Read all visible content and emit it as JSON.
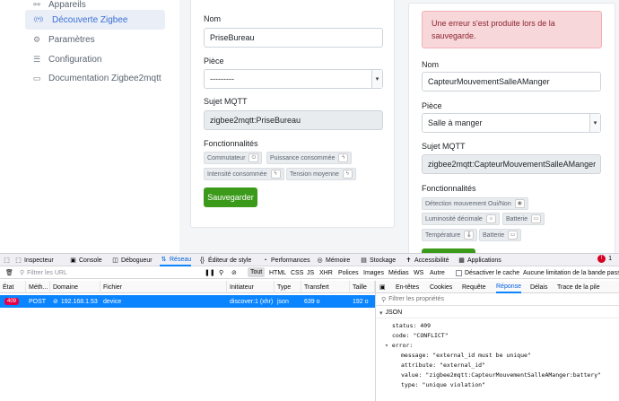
{
  "sidebar": {
    "items": [
      {
        "label": "Appareils",
        "icon": "link-icon",
        "glyph": "⚯",
        "active": false
      },
      {
        "label": "Découverte Zigbee",
        "icon": "broadcast-icon",
        "glyph": "((•))",
        "active": true
      },
      {
        "label": "Paramètres",
        "icon": "gear-icon",
        "glyph": "⚙",
        "active": false
      },
      {
        "label": "Configuration",
        "icon": "sliders-icon",
        "glyph": "☰",
        "active": false
      },
      {
        "label": "Documentation Zigbee2mqtt",
        "icon": "document-icon",
        "glyph": "▭",
        "active": false
      }
    ]
  },
  "card1": {
    "nom_label": "Nom",
    "nom_value": "PriseBureau",
    "piece_label": "Pièce",
    "piece_value": "---------",
    "sujet_label": "Sujet MQTT",
    "sujet_value": "zigbee2mqtt:PriseBureau",
    "fonctions_label": "Fonctionnalités",
    "tags": [
      {
        "label": "Commutateur",
        "icon": "power-icon",
        "glyph": "⏻"
      },
      {
        "label": "Puissance consommée",
        "icon": "bolt-icon",
        "glyph": "ϟ"
      },
      {
        "label": "Intensité consommée",
        "icon": "bolt-icon",
        "glyph": "ϟ"
      },
      {
        "label": "Tension moyenne",
        "icon": "bolt-icon",
        "glyph": "ϟ"
      }
    ],
    "save_label": "Sauvegarder"
  },
  "card2": {
    "alert": "Une erreur s'est produite lors de la sauvegarde.",
    "nom_label": "Nom",
    "nom_value": "CapteurMouvementSalleAManger",
    "piece_label": "Pièce",
    "piece_value": "Salle à manger",
    "sujet_label": "Sujet MQTT",
    "sujet_value": "zigbee2mqtt:CapteurMouvementSalleAManger",
    "fonctions_label": "Fonctionnalités",
    "tags": [
      {
        "label": "Détection mouvement Oui/Non",
        "icon": "eye-icon",
        "glyph": "◉"
      },
      {
        "label": "Luminosité décimale",
        "icon": "sun-icon",
        "glyph": "☼"
      },
      {
        "label": "Batterie",
        "icon": "battery-icon",
        "glyph": "▭"
      },
      {
        "label": "Température",
        "icon": "thermometer-icon",
        "glyph": "🌡"
      },
      {
        "label": "Batterie",
        "icon": "battery-icon",
        "glyph": "▭"
      }
    ]
  },
  "devtools": {
    "tabs": [
      {
        "label": "Inspecteur",
        "glyph": "⬚",
        "icon": "inspector-icon"
      },
      {
        "label": "Console",
        "glyph": "▣",
        "icon": "console-icon"
      },
      {
        "label": "Débogueur",
        "glyph": "◫",
        "icon": "debugger-icon"
      },
      {
        "label": "Réseau",
        "glyph": "⇅",
        "icon": "network-icon",
        "active": true
      },
      {
        "label": "Éditeur de style",
        "glyph": "{}",
        "icon": "style-editor-icon"
      },
      {
        "label": "Performances",
        "glyph": "◔",
        "icon": "performance-icon"
      },
      {
        "label": "Mémoire",
        "glyph": "◎",
        "icon": "memory-icon"
      },
      {
        "label": "Stockage",
        "glyph": "▤",
        "icon": "storage-icon"
      },
      {
        "label": "Accessibilité",
        "glyph": "✝",
        "icon": "accessibility-icon"
      },
      {
        "label": "Applications",
        "glyph": "▦",
        "icon": "applications-icon"
      }
    ],
    "error_count": "1",
    "filter_placeholder": "Filtrer les URL",
    "filter_types": [
      "Tout",
      "HTML",
      "CSS",
      "JS",
      "XHR",
      "Polices",
      "Images",
      "Médias",
      "WS",
      "Autre"
    ],
    "disable_cache": "Désactiver le cache",
    "throttling": "Aucune limitation de la bande passante",
    "columns": [
      "État",
      "Méth...",
      "Domaine",
      "Fichier",
      "Initiateur",
      "Type",
      "Transfert",
      "Taille"
    ],
    "request": {
      "status": "409",
      "method": "POST",
      "domain": "192.168.1.53",
      "file": "device",
      "initiator": "discover:1 (xhr)",
      "type": "json",
      "transfer": "639 o",
      "size": "192 o"
    },
    "detail_tabs": [
      "En-têtes",
      "Cookies",
      "Requête",
      "Réponse",
      "Délais",
      "Trace de la pile"
    ],
    "detail_active": "Réponse",
    "props_placeholder": "Filtrer les propriétés",
    "json_label": "JSON",
    "json": {
      "status_key": "status:",
      "status_val": "409",
      "code_key": "code:",
      "code_val": "\"CONFLICT\"",
      "error_key": "error:",
      "message_key": "message:",
      "message_val": "\"external_id must be unique\"",
      "attribute_key": "attribute:",
      "attribute_val": "\"external_id\"",
      "value_key": "value:",
      "value_val": "\"zigbee2mqtt:CapteurMouvementSalleAManger:battery\"",
      "type_key": "type:",
      "type_val": "\"unique violation\""
    }
  }
}
